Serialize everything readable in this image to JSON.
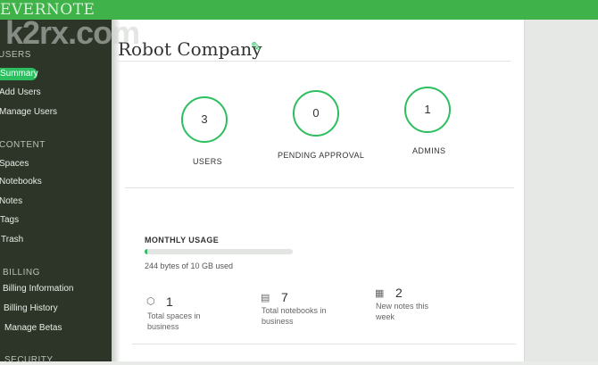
{
  "app": {
    "brand": "EVERNOTE",
    "watermark": "k2rx.com"
  },
  "sidebar": {
    "sections": [
      {
        "header": "USERS",
        "items": [
          "Summary",
          "Add Users",
          "Manage Users"
        ]
      },
      {
        "header": "CONTENT",
        "items": [
          "Spaces",
          "Notebooks",
          "Notes",
          "Tags",
          "Trash"
        ]
      },
      {
        "header": "BILLING",
        "items": [
          "Billing Information",
          "Billing History",
          "Manage Betas"
        ]
      },
      {
        "header": "SECURITY",
        "items": []
      }
    ],
    "active_item": "Summary"
  },
  "page": {
    "title": "Robot Company",
    "edit_icon": "pencil-icon"
  },
  "stats": [
    {
      "value": "3",
      "label": "USERS"
    },
    {
      "value": "0",
      "label": "PENDING APPROVAL"
    },
    {
      "value": "1",
      "label": "ADMINS"
    }
  ],
  "usage": {
    "title": "MONTHLY USAGE",
    "used_text": "244 bytes of 10 GB used",
    "fraction_used": 0.01
  },
  "counts": [
    {
      "icon": "cube-icon",
      "value": "1",
      "label": "Total spaces in business"
    },
    {
      "icon": "notebook-icon",
      "value": "7",
      "label": "Total notebooks in business"
    },
    {
      "icon": "note-icon",
      "value": "2",
      "label": "New notes this week"
    }
  ],
  "colors": {
    "accent": "#2dbe60",
    "topbar": "#3fb34a",
    "sidebar": "#2d3529"
  }
}
